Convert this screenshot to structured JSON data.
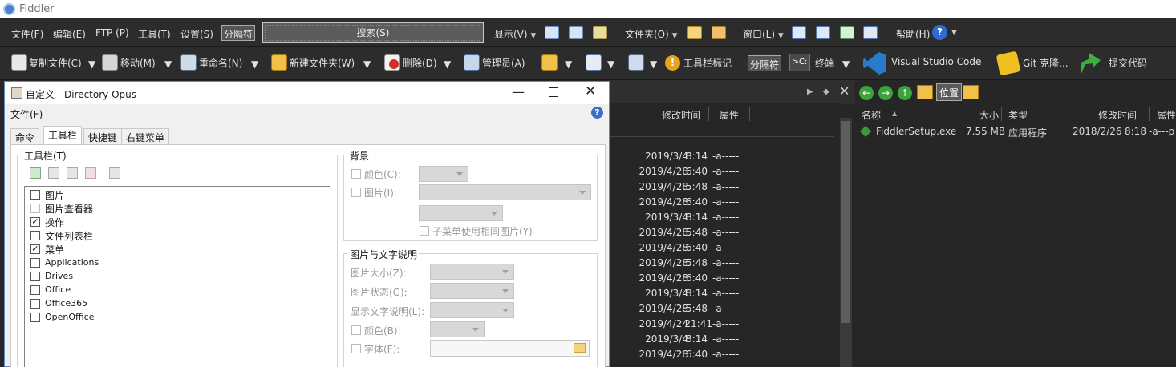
{
  "app": {
    "title": "Fiddler"
  },
  "menubar": {
    "items": [
      "文件(F)",
      "编辑(E)",
      "FTP (P)",
      "工具(T)",
      "设置(S)"
    ],
    "separator": "分隔符",
    "search": "搜索(S)",
    "display": "显示(V)",
    "folders": "文件夹(O)",
    "window": "窗口(L)",
    "help": "帮助(H)"
  },
  "toolbar": {
    "copy": "复制文件(C)",
    "move": "移动(M)",
    "rename": "重命名(N)",
    "newfolder": "新建文件夹(W)",
    "delete": "删除(D)",
    "admin": "管理员(A)",
    "tbmark": "工具栏标记",
    "separator": "分隔符",
    "terminal": "终端",
    "vscode": "Visual Studio Code",
    "gitclone": "Git 克隆...",
    "commit": "提交代码"
  },
  "dialog": {
    "title": "自定义 - Directory Opus",
    "menu": "文件(F)",
    "tabs": [
      "命令",
      "工具栏",
      "快捷键",
      "右键菜单"
    ],
    "toolbars_group": "工具栏(T)",
    "toolbar_list": [
      {
        "label": "图片",
        "checked": false
      },
      {
        "label": "图片查看器",
        "checked": false
      },
      {
        "label": "操作",
        "checked": true
      },
      {
        "label": "文件列表栏",
        "checked": false
      },
      {
        "label": "菜单",
        "checked": true
      },
      {
        "label": "Applications",
        "checked": false
      },
      {
        "label": "Drives",
        "checked": false
      },
      {
        "label": "Office",
        "checked": false
      },
      {
        "label": "Office365",
        "checked": false
      },
      {
        "label": "OpenOffice",
        "checked": false
      }
    ],
    "background_group": "背景",
    "color_label": "颜色(C):",
    "image_label": "图片(I):",
    "submenu_same_image": "子菜单使用相同图片(Y)",
    "image_text_group": "图片与文字说明",
    "image_size": "图片大小(Z):",
    "image_state": "图片状态(G):",
    "show_caption": "显示文字说明(L):",
    "color_b": "颜色(B):",
    "font_f": "字体(F):"
  },
  "midlist": {
    "headers": {
      "modified": "修改时间",
      "attr": "属性"
    },
    "rows": [
      {
        "date": "2019/3/4",
        "time": "8:14",
        "attr": "-a-----"
      },
      {
        "date": "2019/4/28",
        "time": "6:40",
        "attr": "-a-----"
      },
      {
        "date": "2019/4/28",
        "time": "5:48",
        "attr": "-a-----"
      },
      {
        "date": "2019/4/28",
        "time": "6:40",
        "attr": "-a-----"
      },
      {
        "date": "2019/3/4",
        "time": "8:14",
        "attr": "-a-----"
      },
      {
        "date": "2019/4/28",
        "time": "5:48",
        "attr": "-a-----"
      },
      {
        "date": "2019/4/28",
        "time": "6:40",
        "attr": "-a-----"
      },
      {
        "date": "2019/4/28",
        "time": "5:48",
        "attr": "-a-----"
      },
      {
        "date": "2019/4/28",
        "time": "6:40",
        "attr": "-a-----"
      },
      {
        "date": "2019/3/4",
        "time": "8:14",
        "attr": "-a-----"
      },
      {
        "date": "2019/4/28",
        "time": "5:48",
        "attr": "-a-----"
      },
      {
        "date": "2019/4/24",
        "time": "21:41",
        "attr": "-a-----"
      },
      {
        "date": "2019/3/4",
        "time": "8:14",
        "attr": "-a-----"
      },
      {
        "date": "2019/4/28",
        "time": "6:40",
        "attr": "-a-----"
      }
    ]
  },
  "rightlist": {
    "location": "位置",
    "headers": {
      "name": "名称",
      "size": "大小",
      "type": "类型",
      "modified": "修改时间",
      "attr": "属性"
    },
    "rows": [
      {
        "name": "FiddlerSetup.exe",
        "size": "7.55 MB",
        "type": "应用程序",
        "date": "2018/2/26",
        "time": "8:18",
        "attr": "-a---p"
      }
    ]
  }
}
